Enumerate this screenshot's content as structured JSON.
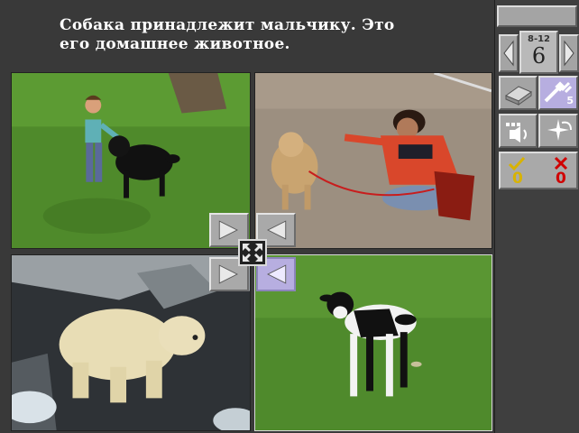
{
  "prompt": {
    "line1": "Собака принадлежит мальчику. Это",
    "line2": "его домашнее животное."
  },
  "photos": [
    {
      "position": "top-left",
      "subject": "boy petting black dog"
    },
    {
      "position": "top-right",
      "subject": "woman with tan dog on leash"
    },
    {
      "position": "bottom-left",
      "subject": "white bear"
    },
    {
      "position": "bottom-right",
      "subject": "black and white calf",
      "selected": true
    }
  ],
  "panel": {
    "age_range": "8-12",
    "level": "6",
    "tools_count": "5",
    "correct_count": "0",
    "wrong_count": "0"
  },
  "icons": [
    "left-arrow-icon",
    "right-arrow-icon",
    "book-icon",
    "satellite-icon",
    "speaker-icon",
    "sparkle-icon",
    "checkmark-icon",
    "x-mark-icon",
    "expand-arrows-icon"
  ],
  "colors": {
    "selected_highlight": "#b7aee0",
    "correct": "#d8b300",
    "wrong": "#d00000"
  }
}
